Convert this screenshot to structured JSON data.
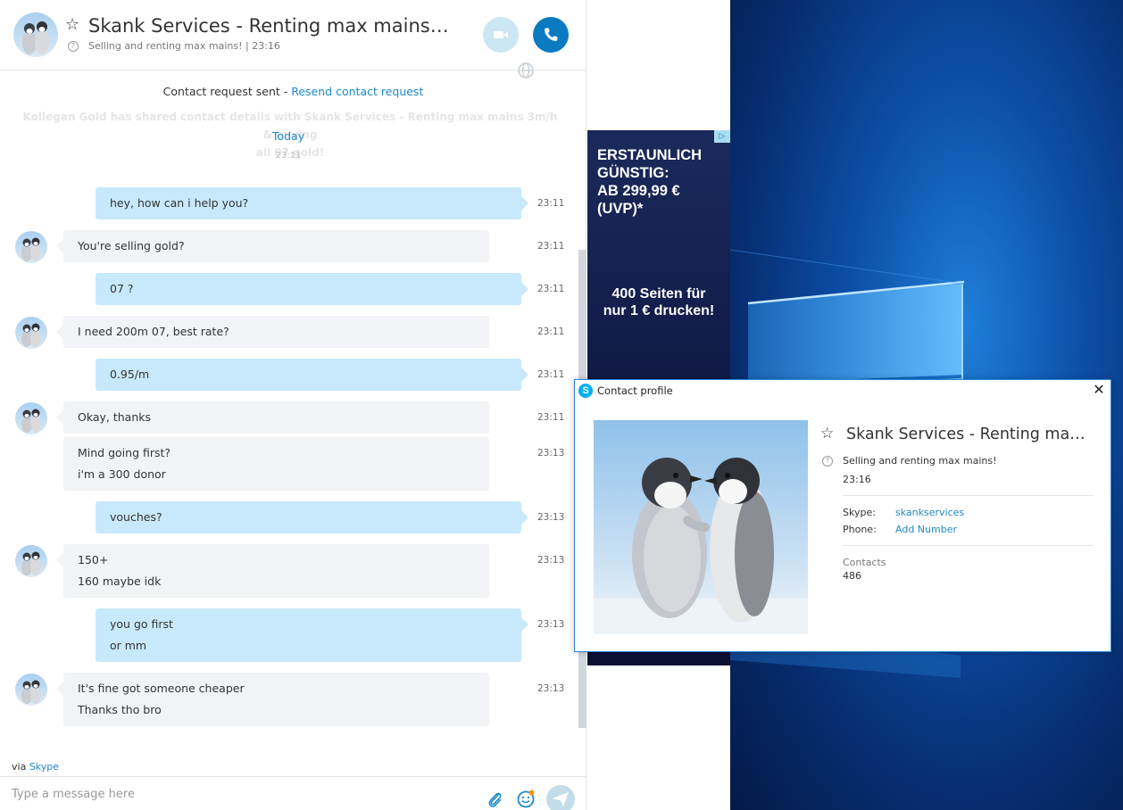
{
  "chat": {
    "contact_name": "Skank Services - Renting max mains 3m/h & buying all 07 gold!",
    "status_text": "Selling and renting max mains!",
    "status_time": "23:16",
    "request_sent": "Contact request sent - ",
    "resend_link": "Resend contact request",
    "faded_note_line1": "Kollegan Gold has shared contact details with Skank Services - Renting max mains 3m/h & buying",
    "faded_note_line2": "all 07 gold!",
    "day_label": "Today",
    "day_time": "23:11",
    "messages": [
      {
        "dir": "out",
        "lines": [
          "hey, how can i help you?"
        ],
        "time": "23:11"
      },
      {
        "dir": "in",
        "lines": [
          "You're selling gold?"
        ],
        "time": "23:11"
      },
      {
        "dir": "out",
        "lines": [
          "07 ?"
        ],
        "time": "23:11"
      },
      {
        "dir": "in",
        "lines": [
          "I need 200m 07, best rate?"
        ],
        "time": "23:11"
      },
      {
        "dir": "out",
        "lines": [
          "0.95/m"
        ],
        "time": "23:11"
      },
      {
        "dir": "in",
        "lines": [
          "Okay, thanks"
        ],
        "time": "23:11"
      },
      {
        "dir": "in",
        "lines": [
          "Mind going first?",
          "i'm a 300 donor"
        ],
        "time": "23:13"
      },
      {
        "dir": "out",
        "lines": [
          "vouches?"
        ],
        "time": "23:13"
      },
      {
        "dir": "in",
        "lines": [
          "150+",
          "160 maybe idk"
        ],
        "time": "23:13"
      },
      {
        "dir": "out",
        "lines": [
          "you go first",
          "or mm"
        ],
        "time": "23:13"
      },
      {
        "dir": "in",
        "lines": [
          "It's fine got someone cheaper",
          "Thanks tho bro"
        ],
        "time": "23:13"
      }
    ],
    "via_prefix": "via ",
    "via_link": "Skype",
    "compose_placeholder": "Type a message here"
  },
  "ad": {
    "badge": "▷",
    "headline": "ERSTAUNLICH\nGÜNSTIG:\nAB 299,99 € (UVP)*",
    "offer": "400 Seiten für\nnur 1 € drucken!"
  },
  "profile": {
    "window_title": "Contact profile",
    "close_glyph": "✕",
    "logo_letter": "S",
    "name": "Skank Services - Renting max mains 3m/h & buying all 07 gold!",
    "status": "Selling and renting max mains!",
    "time": "23:16",
    "skype_label": "Skype:",
    "skype_value": "skankservices",
    "phone_label": "Phone:",
    "phone_value": "Add Number",
    "contacts_label": "Contacts",
    "contacts_value": "486"
  },
  "icons": {
    "star": "☆",
    "help": "?"
  },
  "colors": {
    "accent": "#1e88c9",
    "call_button": "#0a7ac1",
    "outgoing_bubble": "#c7e9fb",
    "incoming_bubble": "#f1f3f6",
    "window_border": "#2b88d8"
  }
}
